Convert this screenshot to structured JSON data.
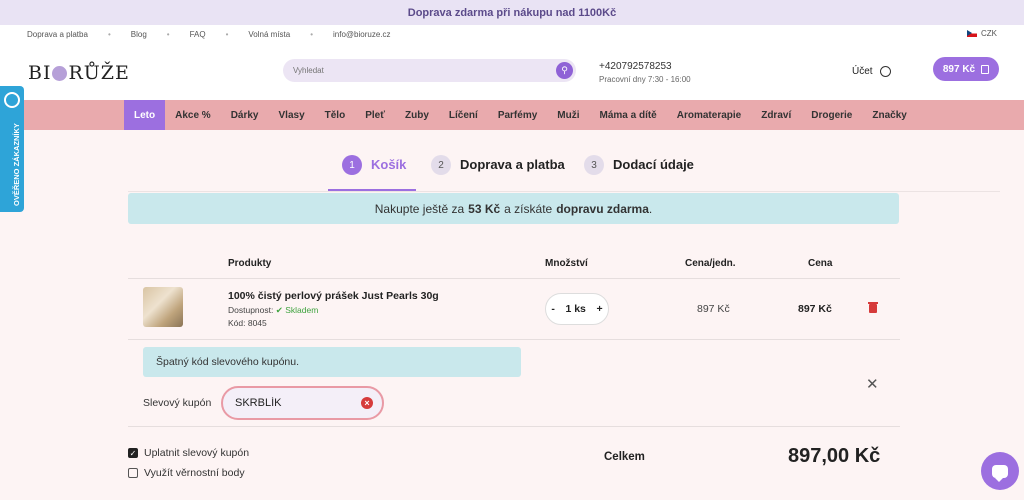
{
  "topbar": {
    "text": "Doprava zdarma při nákupu nad 1100Kč"
  },
  "util_links": [
    "Doprava a platba",
    "Blog",
    "FAQ",
    "Volná místa",
    "info@bioruze.cz"
  ],
  "currency": "CZK",
  "header": {
    "logo": "BIORŮŽE",
    "search_placeholder": "Vyhledat",
    "phone": "+420792578253",
    "hours": "Pracovní dny 7:30 - 16:00",
    "account": "Účet",
    "cart_total": "897 Kč"
  },
  "nav": [
    "Leto",
    "Akce %",
    "Dárky",
    "Vlasy",
    "Tělo",
    "Pleť",
    "Zuby",
    "Líčení",
    "Parfémy",
    "Muži",
    "Máma a dítě",
    "Aromaterapie",
    "Zdraví",
    "Drogerie",
    "Značky"
  ],
  "steps": [
    {
      "num": "1",
      "label": "Košík"
    },
    {
      "num": "2",
      "label": "Doprava a platba"
    },
    {
      "num": "3",
      "label": "Dodací údaje"
    }
  ],
  "promo": {
    "pre": "Nakupte ještě za",
    "amount": "53 Kč",
    "mid": "a získáte",
    "bold": "dopravu zdarma",
    "post": "."
  },
  "table": {
    "headers": {
      "products": "Produkty",
      "qty": "Množství",
      "unit": "Cena/jedn.",
      "price": "Cena"
    },
    "item": {
      "name": "100% čistý perlový prášek Just Pearls 30g",
      "avail_label": "Dostupnost:",
      "avail_value": "Skladem",
      "code": "Kód: 8045",
      "qty_minus": "-",
      "qty": "1 ks",
      "qty_plus": "+",
      "unit_price": "897 Kč",
      "price": "897 Kč"
    }
  },
  "coupon": {
    "error": "Špatný kód slevového kupónu.",
    "label": "Slevový kupón",
    "value": "SKRBLÍK"
  },
  "options": {
    "apply": "Uplatnit slevový kupón",
    "loyalty": "Využít věrnostní body"
  },
  "total": {
    "label": "Celkem",
    "value": "897,00 Kč"
  },
  "verified_badge": "OVĚŘENO ZÁKAZNÍKY",
  "colors": {
    "accent": "#9c6fe0",
    "nav_bg": "#e9aaad",
    "info_bg": "#c9e8ec",
    "error": "#d63b3b"
  }
}
